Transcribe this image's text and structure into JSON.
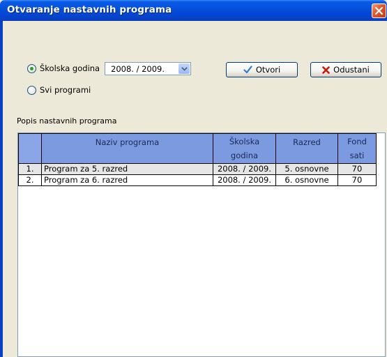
{
  "window": {
    "title": "Otvaranje nastavnih programa"
  },
  "filters": {
    "school_year_radio_label": "Školska godina",
    "school_year_selected": true,
    "school_year_value": "2008. / 2009.",
    "all_programs_radio_label": "Svi programi",
    "all_programs_selected": false
  },
  "buttons": {
    "open_label": "Otvori",
    "cancel_label": "Odustani"
  },
  "list": {
    "section_label": "Popis nastavnih programa",
    "columns": [
      {
        "label": "",
        "sub": ""
      },
      {
        "label": "Naziv programa",
        "sub": ""
      },
      {
        "label": "Školska",
        "sub": "godina"
      },
      {
        "label": "Razred",
        "sub": ""
      },
      {
        "label": "Fond",
        "sub": "sati"
      }
    ],
    "rows": [
      {
        "num": "1.",
        "name": "Program za 5. razred",
        "year": "2008. / 2009.",
        "grade": "5. osnovne",
        "hours": "70"
      },
      {
        "num": "2.",
        "name": "Program za 6. razred",
        "year": "2008. / 2009.",
        "grade": "6. osnovne",
        "hours": "70"
      }
    ]
  },
  "colors": {
    "title_bar": "#0550dc",
    "header_fill": "#7b9ae0",
    "selected_row": "#e6e6e6",
    "check_icon": "#2f78d6",
    "cancel_icon": "#c8170b",
    "radio_dot": "#21a121"
  }
}
